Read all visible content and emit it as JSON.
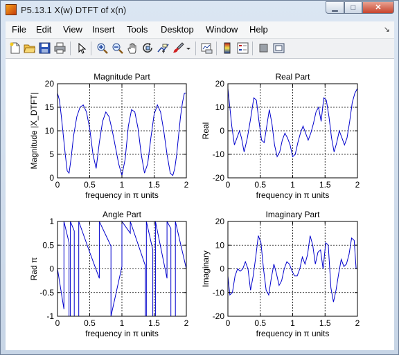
{
  "window": {
    "title": "P5.13.1 X(w) DTFT of x(n)",
    "buttons": {
      "minimize": "▁",
      "maximize": "□",
      "close": "✕"
    }
  },
  "menubar": {
    "items": [
      "File",
      "Edit",
      "View",
      "Insert",
      "Tools",
      "Desktop",
      "Window",
      "Help"
    ],
    "overflow_arrow": "↘"
  },
  "toolbar": {
    "icons": [
      "new-file-icon",
      "open-folder-icon",
      "save-icon",
      "print-icon",
      "pointer-arrow-icon",
      "zoom-in-icon",
      "zoom-out-icon",
      "pan-hand-icon",
      "rotate-3d-icon",
      "data-cursor-icon",
      "brush-icon",
      "brush-dropdown-icon",
      "link-plot-icon",
      "colorbar-icon",
      "legend-icon",
      "hide-plot-tools-icon",
      "show-plot-tools-icon"
    ]
  },
  "colors": {
    "line": "#0000cc",
    "axes": "#000000",
    "grid": "#000000",
    "figure_bg": "#ffffff"
  },
  "chart_data": [
    {
      "type": "line",
      "title": "Magnitude Part",
      "xlabel": "frequency in π units",
      "ylabel": "Magnitude  |X_DTFT|",
      "xlim": [
        0,
        2
      ],
      "ylim": [
        0,
        20
      ],
      "xticks": [
        "0",
        "0.5",
        "1",
        "1.5",
        "2"
      ],
      "yticks": [
        "0",
        "5",
        "10",
        "15",
        "20"
      ],
      "grid": true,
      "series": [
        {
          "x": [
            0,
            0.03,
            0.06,
            0.09,
            0.12,
            0.15,
            0.18,
            0.21,
            0.25,
            0.3,
            0.35,
            0.4,
            0.45,
            0.5,
            0.55,
            0.6,
            0.65,
            0.7,
            0.75,
            0.8,
            0.85,
            0.9,
            0.95,
            1.0,
            1.05,
            1.1,
            1.15,
            1.2,
            1.25,
            1.3,
            1.35,
            1.4,
            1.45,
            1.5,
            1.55,
            1.6,
            1.65,
            1.7,
            1.75,
            1.79,
            1.82,
            1.85,
            1.88,
            1.91,
            1.94,
            1.97,
            2.0
          ],
          "y": [
            18,
            16.5,
            13,
            9,
            5,
            1.5,
            1,
            4,
            9,
            13,
            15,
            15.5,
            14,
            10.5,
            5,
            2,
            7.5,
            12,
            14,
            13,
            10,
            6.5,
            3,
            0.5,
            4,
            11,
            14.5,
            14,
            10.5,
            5,
            1,
            3,
            8.5,
            13.5,
            15.5,
            14,
            10,
            5,
            1,
            0.5,
            2,
            5,
            9,
            13,
            16,
            18,
            18
          ]
        }
      ]
    },
    {
      "type": "line",
      "title": "Real Part",
      "xlabel": "frequency in π units",
      "ylabel": "Real",
      "xlim": [
        0,
        2
      ],
      "ylim": [
        -20,
        20
      ],
      "xticks": [
        "0",
        "0.5",
        "1",
        "1.5",
        "2"
      ],
      "yticks": [
        "-20",
        "-10",
        "0",
        "10",
        "20"
      ],
      "grid": true,
      "series": [
        {
          "x": [
            0,
            0.03,
            0.06,
            0.1,
            0.14,
            0.18,
            0.21,
            0.25,
            0.3,
            0.35,
            0.4,
            0.44,
            0.48,
            0.52,
            0.56,
            0.6,
            0.64,
            0.68,
            0.72,
            0.76,
            0.8,
            0.84,
            0.88,
            0.92,
            0.96,
            1.0,
            1.04,
            1.08,
            1.12,
            1.16,
            1.2,
            1.24,
            1.28,
            1.32,
            1.36,
            1.4,
            1.44,
            1.48,
            1.52,
            1.56,
            1.6,
            1.64,
            1.68,
            1.72,
            1.76,
            1.8,
            1.84,
            1.88,
            1.92,
            1.96,
            2.0
          ],
          "y": [
            18,
            10,
            2,
            -6,
            -3,
            0,
            -3,
            -9,
            -3,
            5,
            14,
            13,
            4,
            -4,
            -5,
            2,
            9,
            3,
            -6,
            -11,
            -9,
            -4,
            -1,
            -3,
            -6,
            -11,
            -10,
            -5,
            -1,
            2,
            -1,
            -4,
            -1,
            3,
            8,
            10,
            4,
            14,
            13,
            6,
            -3,
            -9,
            -5,
            0,
            -3,
            -6,
            -3,
            4,
            12,
            16,
            18
          ]
        }
      ]
    },
    {
      "type": "line",
      "title": "Angle Part",
      "xlabel": "frequency in π units",
      "ylabel": "Rad π",
      "xlim": [
        0,
        2
      ],
      "ylim": [
        -1,
        1
      ],
      "xticks": [
        "0",
        "0.5",
        "1",
        "1.5",
        "2"
      ],
      "yticks": [
        "-1",
        "-0.5",
        "0",
        "0.5",
        "1"
      ],
      "grid": true,
      "series": [
        {
          "x": [
            0,
            0.1,
            0.1,
            0.18,
            0.18,
            0.2,
            0.2,
            0.26,
            0.26,
            0.33,
            0.33,
            0.5,
            0.65,
            0.65,
            0.83,
            0.83,
            1.0,
            1.0,
            1.13,
            1.13,
            1.36,
            1.36,
            1.38,
            1.38,
            1.48,
            1.48,
            1.52,
            1.52,
            1.7,
            1.7,
            1.76,
            1.76,
            1.83,
            1.83,
            2.0
          ],
          "y": [
            0,
            -0.85,
            1,
            0.55,
            -1,
            -1,
            1,
            0.8,
            -1,
            -1,
            1,
            0.35,
            -0.2,
            1,
            0.48,
            -1,
            0.05,
            1,
            0.75,
            1,
            0.08,
            -1,
            -1,
            1,
            0.4,
            -1,
            -1,
            1,
            -0.2,
            1,
            0.85,
            -1,
            -1,
            1,
            0
          ]
        }
      ]
    },
    {
      "type": "line",
      "title": "Imaginary Part",
      "xlabel": "frequency in π units",
      "ylabel": "Imaginary",
      "xlim": [
        0,
        2
      ],
      "ylim": [
        -20,
        20
      ],
      "xticks": [
        "0",
        "0.5",
        "1",
        "1.5",
        "2"
      ],
      "yticks": [
        "-20",
        "-10",
        "0",
        "10",
        "20"
      ],
      "grid": true,
      "series": [
        {
          "x": [
            0,
            0.03,
            0.07,
            0.11,
            0.15,
            0.19,
            0.23,
            0.27,
            0.31,
            0.35,
            0.39,
            0.43,
            0.47,
            0.51,
            0.55,
            0.59,
            0.63,
            0.67,
            0.71,
            0.75,
            0.79,
            0.83,
            0.87,
            0.91,
            0.95,
            0.99,
            1.03,
            1.07,
            1.11,
            1.15,
            1.19,
            1.23,
            1.27,
            1.31,
            1.35,
            1.39,
            1.43,
            1.47,
            1.51,
            1.55,
            1.59,
            1.63,
            1.67,
            1.71,
            1.75,
            1.79,
            1.83,
            1.87,
            1.91,
            1.95,
            1.98,
            2.0
          ],
          "y": [
            -3,
            -11,
            -10,
            -3,
            0,
            -1,
            0,
            3,
            0,
            -9,
            -3,
            5,
            14,
            11,
            0,
            -9,
            -11,
            -4,
            2,
            -2,
            -7,
            -5,
            0,
            3,
            2,
            -1,
            -3,
            -3,
            0,
            5,
            2,
            6,
            14,
            10,
            2,
            7,
            8,
            0,
            11,
            10,
            -8,
            -14,
            -9,
            -2,
            4,
            1,
            2,
            6,
            13,
            12,
            0,
            0
          ]
        }
      ]
    }
  ]
}
